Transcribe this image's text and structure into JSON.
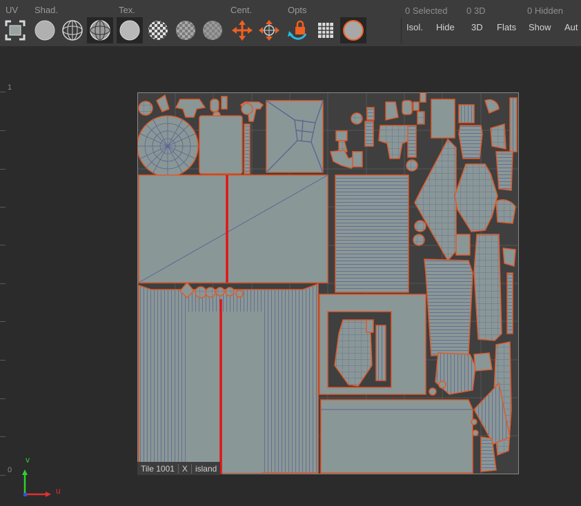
{
  "toolbar": {
    "sections": {
      "uv": "UV",
      "shad": "Shad.",
      "tex": "Tex.",
      "cent": "Cent.",
      "opts": "Opts"
    },
    "status": {
      "selected": "0 Selected",
      "three_d": "0 3D",
      "hidden": "0 Hidden"
    },
    "buttons": {
      "isol": "Isol.",
      "hide": "Hide",
      "three_d": "3D",
      "flats": "Flats",
      "show": "Show",
      "auto": "Aut"
    }
  },
  "icons": [
    "frame-icon",
    "shaded-sphere-icon",
    "wireframe-sphere-icon",
    "wire-on-shaded-sphere-icon",
    "plain-texture-sphere-icon",
    "checker-sphere-icon",
    "checker-dim-sphere-icon",
    "checker-faint-sphere-icon",
    "center-arrows-icon",
    "center-crosshair-icon",
    "lock-rotate-icon",
    "grid-icon",
    "display-sphere-icon"
  ],
  "ruler": {
    "top": "1",
    "bottom": "0"
  },
  "tile": {
    "name": "Tile 1001",
    "axis": "X",
    "mode": "island"
  },
  "axes": {
    "u": "u",
    "v": "v"
  },
  "colors": {
    "island_fill": "#8a9797",
    "island_border": "#e05a2a",
    "wire": "#5b6690",
    "seam": "#e31414",
    "axis_u": "#e03030",
    "axis_v": "#30d030",
    "accent_orange": "#f06020"
  }
}
